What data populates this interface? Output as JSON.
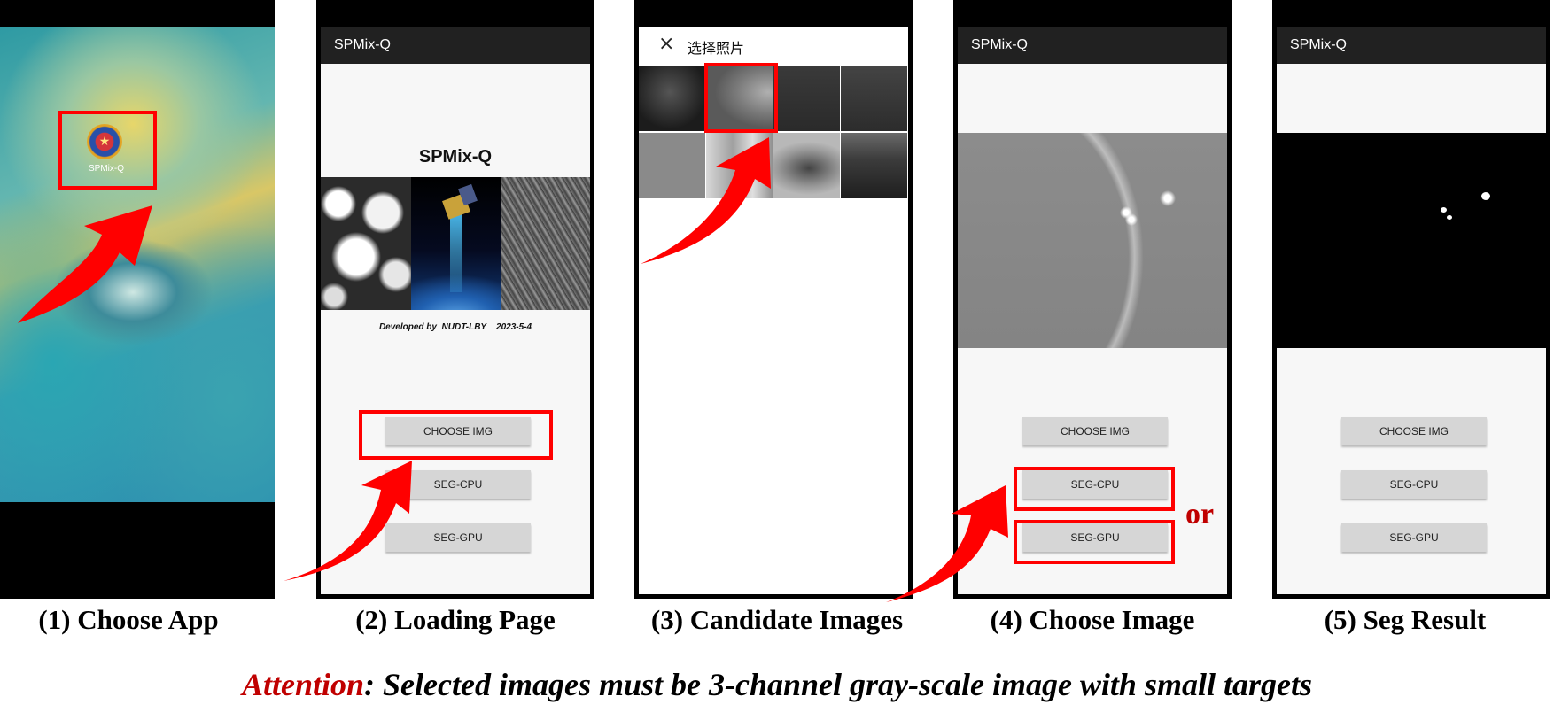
{
  "panel1": {
    "app_icon_label": "SPMix-Q",
    "caption": "(1) Choose App"
  },
  "panel2": {
    "appbar_title": "SPMix-Q",
    "splash_title": "SPMix-Q",
    "developer_credit": "Developed by  NUDT-LBY    2023-5-4",
    "buttons": [
      "CHOOSE IMG",
      "SEG-CPU",
      "SEG-GPU"
    ],
    "caption": "(2) Loading Page"
  },
  "panel3": {
    "close_symbol": "×",
    "picker_title": "选择照片",
    "caption": "(3) Candidate Images"
  },
  "panel4": {
    "appbar_title": "SPMix-Q",
    "buttons": [
      "CHOOSE IMG",
      "SEG-CPU",
      "SEG-GPU"
    ],
    "or_label": "or",
    "caption": "(4) Choose Image"
  },
  "panel5": {
    "appbar_title": "SPMix-Q",
    "buttons": [
      "CHOOSE IMG",
      "SEG-CPU",
      "SEG-GPU"
    ],
    "caption": "(5) Seg Result"
  },
  "footer": {
    "attention_word": "Attention",
    "attention_text": ": Selected images must be 3-channel gray-scale image with small targets"
  },
  "colors": {
    "highlight": "#ff0000",
    "attention": "#c00000",
    "appbar": "#212121",
    "button": "#d6d6d6"
  },
  "icons": [
    "app-logo-icon",
    "close-icon",
    "pointer-arrow-icon"
  ]
}
